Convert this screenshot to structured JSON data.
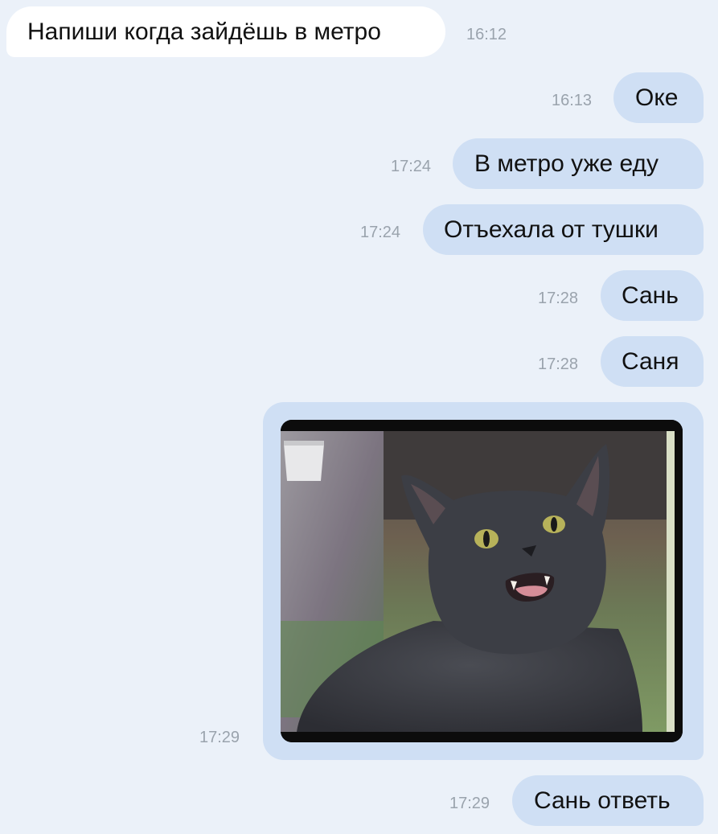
{
  "messages": [
    {
      "direction": "in",
      "text": "Напиши когда зайдёшь в метро",
      "time": "16:12"
    },
    {
      "direction": "out",
      "text": "Оке",
      "time": "16:13"
    },
    {
      "direction": "out",
      "text": "В метро уже еду",
      "time": "17:24"
    },
    {
      "direction": "out",
      "text": "Отъехала от тушки",
      "time": "17:24"
    },
    {
      "direction": "out",
      "text": "Сань",
      "time": "17:28"
    },
    {
      "direction": "out",
      "text": "Саня",
      "time": "17:28"
    },
    {
      "direction": "out",
      "type": "image",
      "image": "cat-meme-photo",
      "time": "17:29"
    },
    {
      "direction": "out",
      "text": "Сань ответь",
      "time": "17:29"
    }
  ],
  "colors": {
    "background": "#ebf1f9",
    "incoming_bubble": "#ffffff",
    "outgoing_bubble": "#cfdff4",
    "time_text": "#9aa3ad"
  }
}
